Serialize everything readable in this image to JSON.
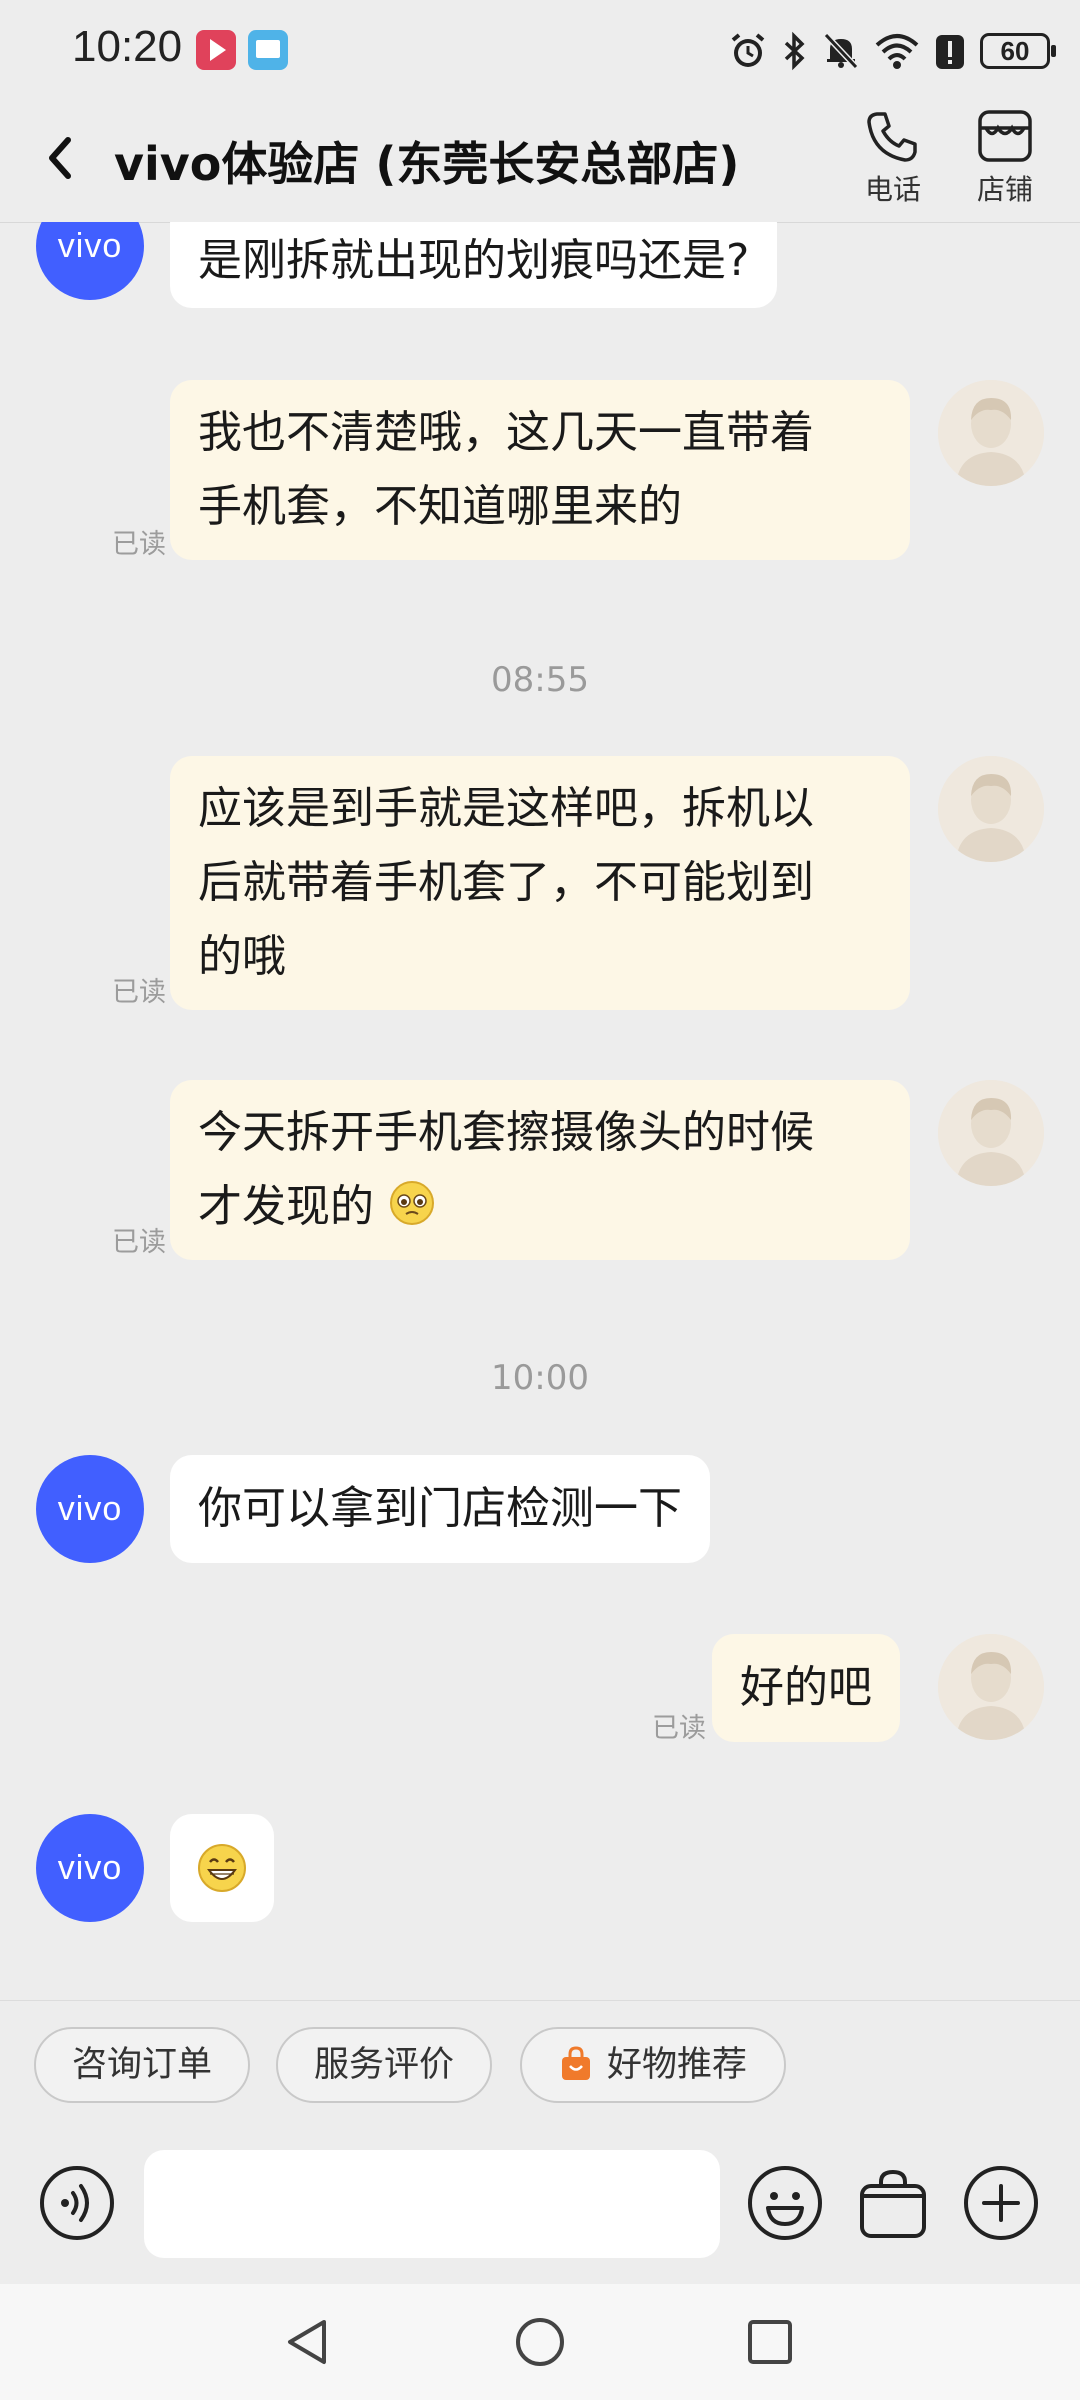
{
  "status_bar": {
    "time": "10:20",
    "battery": "60",
    "icons": [
      "alarm-icon",
      "bluetooth-icon",
      "mute-icon",
      "wifi-icon",
      "alert-icon",
      "battery-icon"
    ]
  },
  "header": {
    "title": "vivo体验店 (东莞长安总部店)",
    "phone_label": "电话",
    "shop_label": "店铺"
  },
  "avatar_text": "vivo",
  "read_label": "已读",
  "messages": [
    {
      "from": "shop",
      "text": "是刚拆就出现的划痕吗还是?"
    },
    {
      "from": "me",
      "lines": [
        "我也不清楚哦，这几天一直带着",
        "手机套，不知道哪里来的"
      ]
    },
    {
      "type": "time",
      "text": "08:55"
    },
    {
      "from": "me",
      "lines": [
        "应该是到手就是这样吧，拆机以",
        "后就带着手机套了，不可能划到",
        "的哦"
      ]
    },
    {
      "from": "me",
      "lines": [
        "今天拆开手机套擦摄像头的时候",
        "才发现的"
      ],
      "emoji": "pleading-face"
    },
    {
      "type": "time",
      "text": "10:00"
    },
    {
      "from": "shop",
      "text": "你可以拿到门店检测一下"
    },
    {
      "from": "me",
      "text": "好的吧"
    },
    {
      "from": "shop",
      "emoji": "grinning-face"
    }
  ],
  "quick_replies": [
    "咨询订单",
    "服务评价",
    "好物推荐"
  ],
  "input": {
    "placeholder": ""
  },
  "colors": {
    "vivo_blue": "#415fff",
    "out_bubble": "#fdf7e6",
    "background": "#ededed"
  }
}
